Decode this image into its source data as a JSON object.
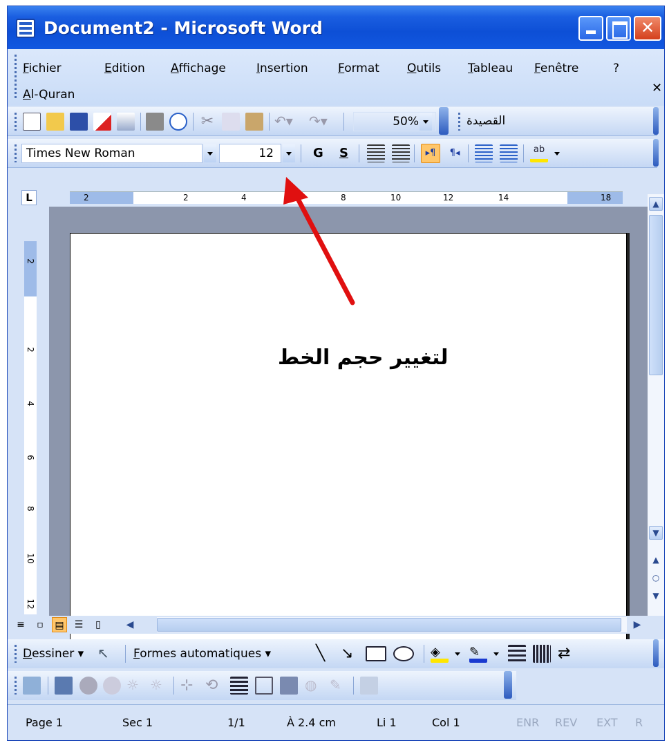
{
  "window": {
    "title": "Document2 - Microsoft Word"
  },
  "menubar": {
    "items": [
      "Fichier",
      "Edition",
      "Affichage",
      "Insertion",
      "Format",
      "Outils",
      "Tableau",
      "Fenêtre",
      "?",
      "Al-Quran"
    ]
  },
  "standard_toolbar": {
    "zoom": "50%",
    "arabic_style": "القصيدة"
  },
  "formatting_toolbar": {
    "font_name": "Times New Roman",
    "font_size": "12",
    "bold_label": "G",
    "shadow_label": "S"
  },
  "ruler": {
    "h_labels": [
      "2",
      "2",
      "4",
      "6",
      "8",
      "10",
      "12",
      "14",
      "18"
    ],
    "v_labels": [
      "2",
      "2",
      "4",
      "6",
      "8",
      "10",
      "12"
    ]
  },
  "annotation": {
    "text": "لتغيير حجم الخط",
    "color": "#e01010"
  },
  "drawing_toolbar": {
    "draw_label": "Dessiner",
    "autoshapes_label": "Formes automatiques"
  },
  "statusbar": {
    "page": "Page 1",
    "section": "Sec 1",
    "pages": "1/1",
    "at": "À 2.4 cm",
    "line": "Li 1",
    "col": "Col 1",
    "rec": "ENR",
    "rev": "REV",
    "ext": "EXT",
    "ovr": "R"
  }
}
